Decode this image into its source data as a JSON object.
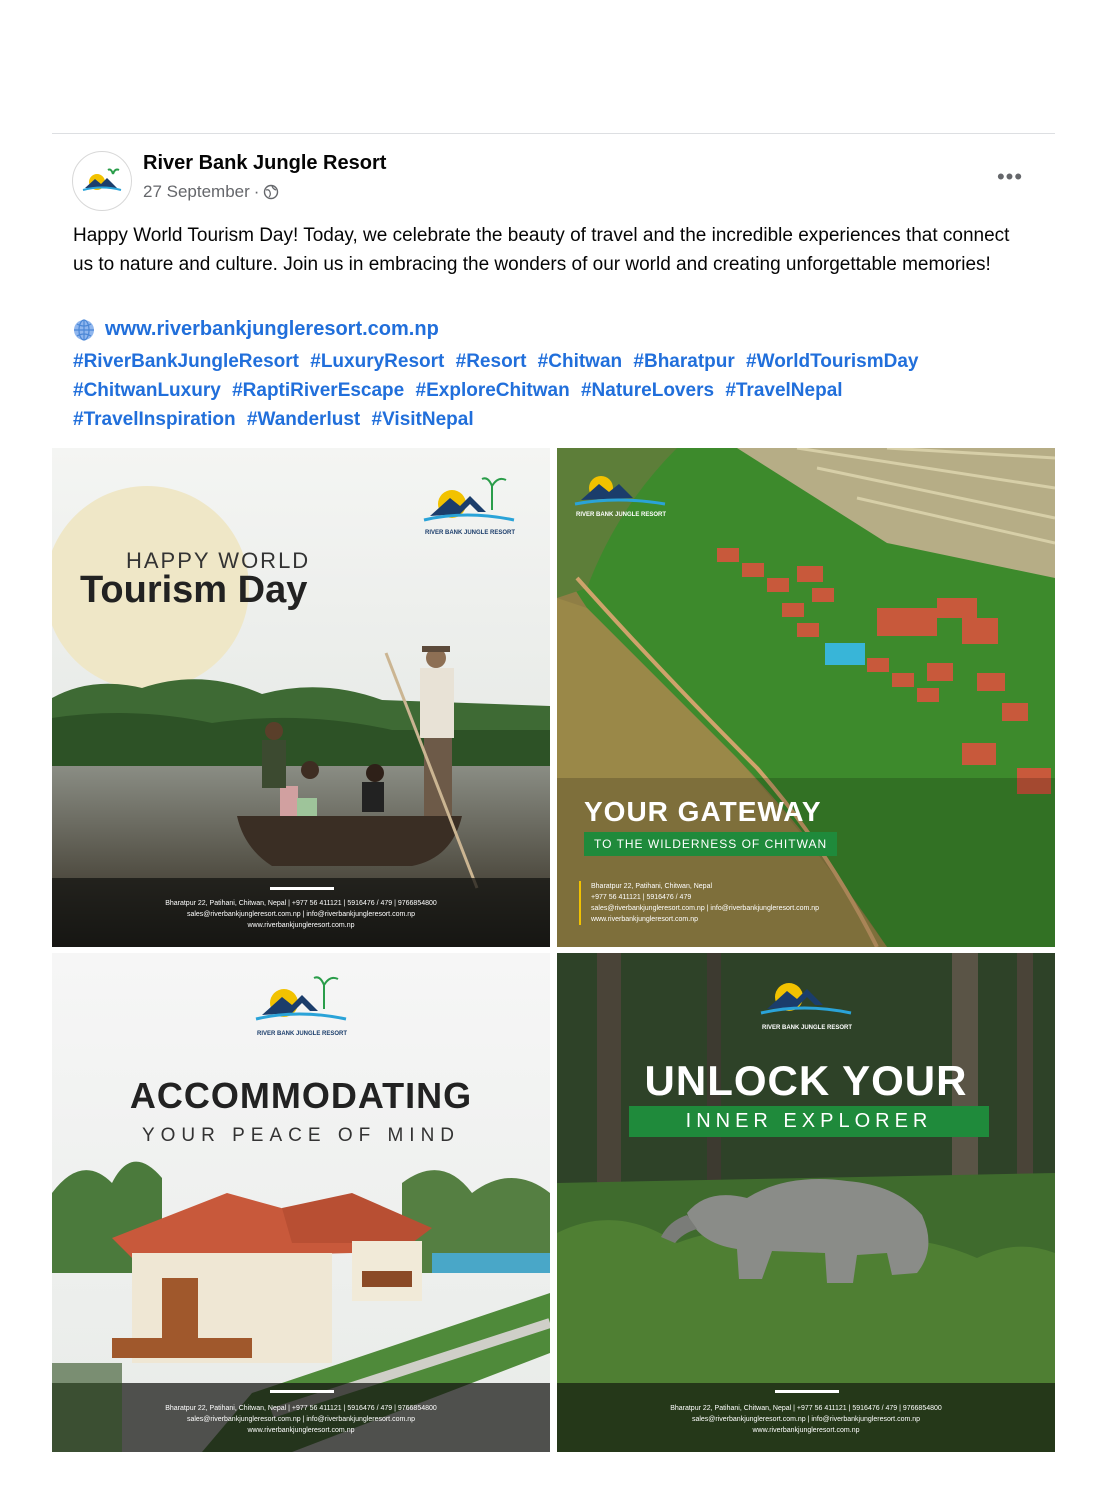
{
  "post": {
    "page_name": "River Bank Jungle Resort",
    "date": "27 September",
    "date_separator": "·",
    "more_label": "•••",
    "text": "Happy World Tourism Day! Today, we celebrate the beauty of travel and the incredible experiences that connect us to nature and culture. Join us in embracing the wonders of our world and creating unforgettable memories!",
    "website": "www.riverbankjungleresort.com.np",
    "hashtags": [
      "#RiverBankJungleResort",
      "#LuxuryResort",
      "#Resort",
      "#Chitwan",
      "#Bharatpur",
      "#WorldTourismDay",
      "#ChitwanLuxury",
      "#RaptiRiverEscape",
      "#ExploreChitwan",
      "#NatureLovers",
      "#TravelNepal",
      "#TravelInspiration",
      "#Wanderlust",
      "#VisitNepal"
    ]
  },
  "logo_text": "RIVER BANK JUNGLE RESORT",
  "photos": {
    "tile1": {
      "line1": "HAPPY WORLD",
      "line2": "Tourism Day",
      "footer1": "Bharatpur 22, Patihani, Chitwan, Nepal | +977 56 411121 | 5916476 / 479 | 9766854800",
      "footer2": "sales@riverbankjungleresort.com.np | info@riverbankjungleresort.com.np",
      "footer3": "www.riverbankjungleresort.com.np"
    },
    "tile2": {
      "title": "YOUR GATEWAY",
      "subtitle": "TO THE WILDERNESS OF CHITWAN",
      "footer1": "Bharatpur 22, Patihani, Chitwan, Nepal",
      "footer2": "+977 56 411121 | 5916476 / 479",
      "footer3": "sales@riverbankjungleresort.com.np | info@riverbankjungleresort.com.np",
      "footer4": "www.riverbankjungleresort.com.np"
    },
    "tile3": {
      "title": "ACCOMMODATING",
      "subtitle": "YOUR PEACE OF MIND",
      "footer1": "Bharatpur 22, Patihani, Chitwan, Nepal | +977 56 411121 | 5916476 / 479 | 9766854800",
      "footer2": "sales@riverbankjungleresort.com.np | info@riverbankjungleresort.com.np",
      "footer3": "www.riverbankjungleresort.com.np"
    },
    "tile4": {
      "title": "UNLOCK YOUR",
      "subtitle": "INNER EXPLORER",
      "footer1": "Bharatpur 22, Patihani, Chitwan, Nepal | +977 56 411121 | 5916476 / 479 | 9766854800",
      "footer2": "sales@riverbankjungleresort.com.np | info@riverbankjungleresort.com.np",
      "footer3": "www.riverbankjungleresort.com.np"
    }
  },
  "colors": {
    "link": "#216fdb",
    "green_banner": "#1f8a3b",
    "sun": "#f2c200",
    "roof": "#c8593b"
  }
}
